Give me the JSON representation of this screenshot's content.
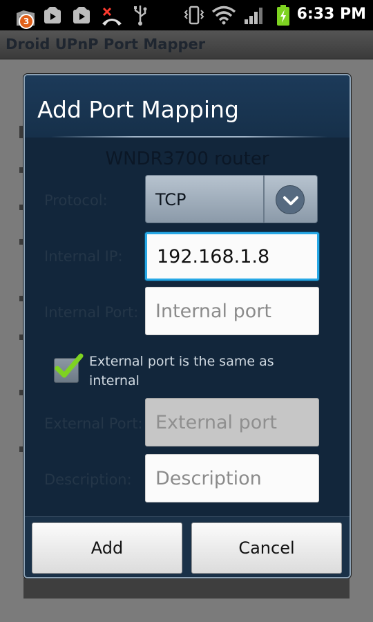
{
  "status_bar": {
    "notification_count": "3",
    "time": "6:33 PM",
    "icons": [
      "notification-icon",
      "youtube-icon",
      "youtube-icon",
      "missed-call-icon",
      "usb-icon",
      "vibrate-icon",
      "wifi-icon",
      "signal-icon",
      "battery-charging-icon"
    ]
  },
  "app": {
    "title": "Droid UPnP Port Mapper"
  },
  "dialog": {
    "title": "Add Port Mapping",
    "router_name": "WNDR3700 router",
    "protocol": {
      "label": "Protocol:",
      "selected": "TCP"
    },
    "internal_ip": {
      "label": "Internal IP:",
      "value": "192.168.1.8"
    },
    "internal_port": {
      "label": "Internal Port:",
      "placeholder": "Internal port"
    },
    "same_port_checkbox": {
      "label": "External port is the same as internal",
      "checked": true
    },
    "external_port": {
      "label": "External Port:",
      "placeholder": "External port",
      "enabled": false
    },
    "description": {
      "label": "Description:",
      "placeholder": "Description"
    },
    "buttons": {
      "add": "Add",
      "cancel": "Cancel"
    }
  },
  "colors": {
    "dialog_bg": "#12263b",
    "focus_accent": "#27a8e6",
    "check_green": "#7ed321",
    "badge_orange": "#e0601a"
  }
}
